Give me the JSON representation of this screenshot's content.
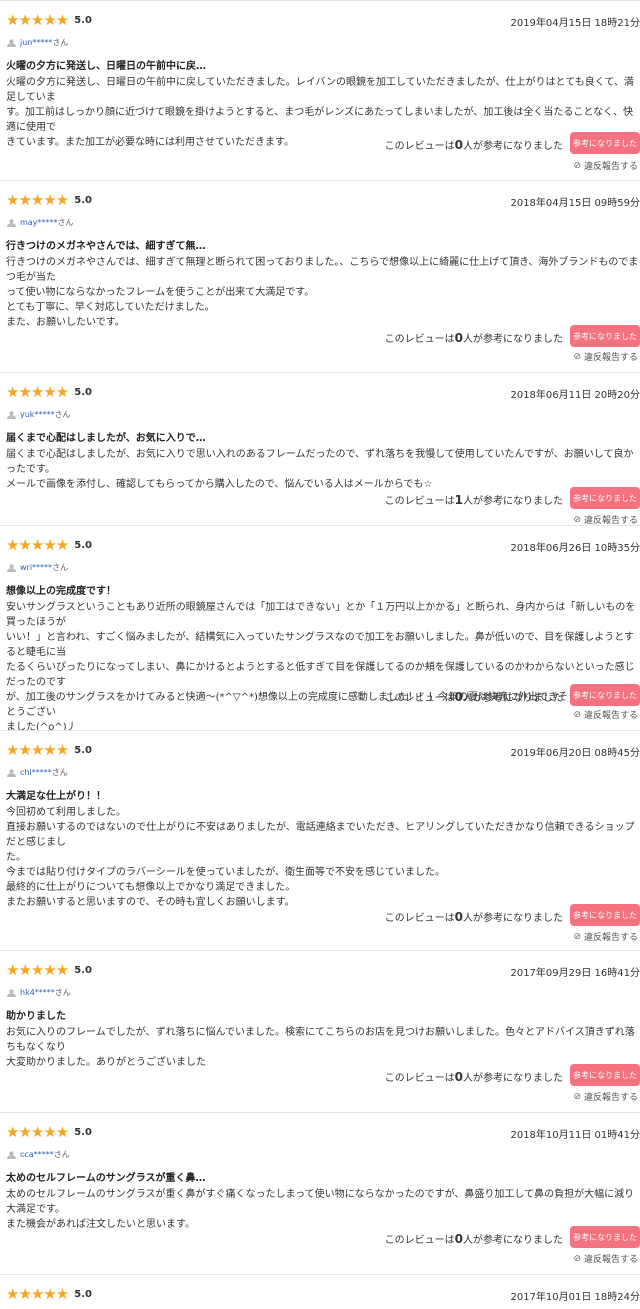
{
  "reviews": [
    {
      "stars": "★★★★★",
      "score": "5.0",
      "date": "2019年04月15日 18時21分",
      "user": "jun*****",
      "user_suffix": "さん",
      "title": "火曜の夕方に発送し、日曜日の午前中に戻…",
      "body": "火曜の夕方に発送し、日曜日の午前中に戻していただきました。レイバンの眼鏡を加工していただきましたが、仕上がりはとても良くて、満足していま\nす。加工前はしっかり顔に近づけて眼鏡を掛けようとすると、まつ毛がレンズにあたってしまいましたが、加工後は全く当たることなく、快適に使用で\nきています。また加工が必要な時には利用させていただきます。",
      "helpful_prefix": "このレビューは",
      "helpful_count": "0",
      "helpful_suffix": "人が参考になりました",
      "button": "参考になりました",
      "report": "違反報告する"
    },
    {
      "stars": "★★★★★",
      "score": "5.0",
      "date": "2018年04月15日 09時59分",
      "user": "may*****",
      "user_suffix": "さん",
      "title": "行きつけのメガネやさんでは、細すぎて無…",
      "body": "行きつけのメガネやさんでは、細すぎて無理と断られて困っておりました。、こちらで想像以上に綺麗に仕上げて頂き、海外ブランドものでまつ毛が当た\nって使い物にならなかったフレームを使うことが出来て大満足です。\nとても丁寧に、早く対応していただけました。\nまた、お願いしたいです。",
      "helpful_prefix": "このレビューは",
      "helpful_count": "0",
      "helpful_suffix": "人が参考になりました",
      "button": "参考になりました",
      "report": "違反報告する"
    },
    {
      "stars": "★★★★★",
      "score": "5.0",
      "date": "2018年06月11日 20時20分",
      "user": "yuk*****",
      "user_suffix": "さん",
      "title": "届くまで心配はしましたが、お気に入りで…",
      "body": "届くまで心配はしましたが、お気に入りで思い入れのあるフレームだったので、ずれ落ちを我慢して使用していたんですが、お願いして良かったです。\nメールで画像を添付し、確認してもらってから購入したので、悩んでいる人はメールからでも☆",
      "helpful_prefix": "このレビューは",
      "helpful_count": "1",
      "helpful_suffix": "人が参考になりました",
      "button": "参考になりました",
      "report": "違反報告する"
    },
    {
      "stars": "★★★★★",
      "score": "5.0",
      "date": "2018年06月26日 10時35分",
      "user": "wri*****",
      "user_suffix": "さん",
      "title": "想像以上の完成度です！",
      "body": "安いサングラスということもあり近所の眼鏡屋さんでは「加工はできない」とか「１万円以上かかる」と断られ、身内からは「新しいものを買ったほうが\nいい！」と言われ、すごく悩みましたが、結構気に入っていたサングラスなので加工をお願いしました。鼻が低いので、目を保護しようとすると睫毛に当\nたるくらいぴったりになってしまい、鼻にかけるとようとすると低すぎて目を保護してるのか頬を保護しているのかわからないといった感じだったのです\nが、加工後のサングラスをかけてみると快適〜(*^▽^*)想像以上の完成度に感動しました！！！今年の夏は快適に外出できそうです！ありがとうござい\nました(^o^)丿",
      "helpful_prefix": "このレビューは",
      "helpful_count": "0",
      "helpful_suffix": "人が参考になりました",
      "button": "参考になりました",
      "report": "違反報告する"
    },
    {
      "stars": "★★★★★",
      "score": "5.0",
      "date": "2019年06月20日 08時45分",
      "user": "chi*****",
      "user_suffix": "さん",
      "title": "大満足な仕上がり！！",
      "body": "今回初めて利用しました。\n直接お願いするのではないので仕上がりに不安はありましたが、電話連絡までいただき、ヒアリングしていただきかなり信頼できるショップだと感じまし\nた。\n今までは貼り付けタイプのラバーシールを使っていましたが、衛生面等で不安を感じていました。\n最終的に仕上がりについても想像以上でかなり満足できました。\nまたお願いすると思いますので、その時も宜しくお願いします。",
      "helpful_prefix": "このレビューは",
      "helpful_count": "0",
      "helpful_suffix": "人が参考になりました",
      "button": "参考になりました",
      "report": "違反報告する"
    },
    {
      "stars": "★★★★★",
      "score": "5.0",
      "date": "2017年09月29日 16時41分",
      "user": "hk4*****",
      "user_suffix": "さん",
      "title": "助かりました",
      "body": "お気に入りのフレームでしたが、ずれ落ちに悩んでいました。検索にてこちらのお店を見つけお願いしました。色々とアドバイス頂きずれ落ちもなくなり\n大変助かりました。ありがとうございました",
      "helpful_prefix": "このレビューは",
      "helpful_count": "0",
      "helpful_suffix": "人が参考になりました",
      "button": "参考になりました",
      "report": "違反報告する"
    },
    {
      "stars": "★★★★★",
      "score": "5.0",
      "date": "2018年10月11日 01時41分",
      "user": "cca*****",
      "user_suffix": "さん",
      "title": "太めのセルフレームのサングラスが重く鼻…",
      "body": "太めのセルフレームのサングラスが重く鼻がすぐ痛くなったしまって使い物にならなかったのですが、鼻盛り加工して鼻の負担が大幅に減り大満足です。\nまた機会があれば注文したいと思います。",
      "helpful_prefix": "このレビューは",
      "helpful_count": "0",
      "helpful_suffix": "人が参考になりました",
      "button": "参考になりました",
      "report": "違反報告する"
    },
    {
      "stars": "★★★★★",
      "score": "5.0",
      "date": "2017年10月01日 18時24分"
    }
  ]
}
